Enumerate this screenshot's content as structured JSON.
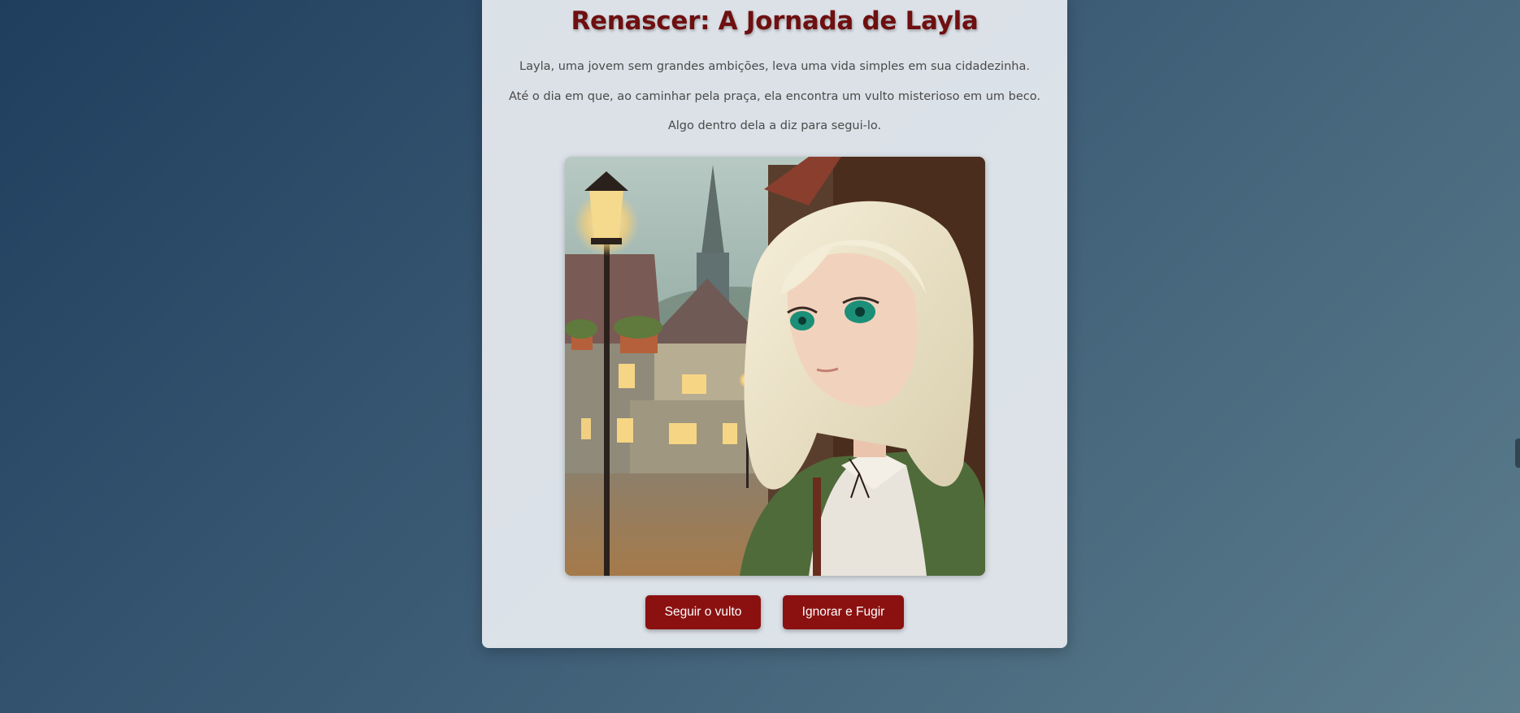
{
  "story": {
    "title": "Renascer: A Jornada de Layla",
    "paragraphs": [
      "Layla, uma jovem sem grandes ambições, leva uma vida simples em sua cidadezinha.",
      "Até o dia em que, ao caminhar pela praça, ela encontra um vulto misterioso em um beco.",
      "Algo dentro dela a diz para segui-lo."
    ]
  },
  "choices": {
    "follow_label": "Seguir o vulto",
    "ignore_label": "Ignorar e Fugir"
  },
  "colors": {
    "title": "#6e0f10",
    "button": "#8b1111",
    "card": "#e2e7ec"
  }
}
